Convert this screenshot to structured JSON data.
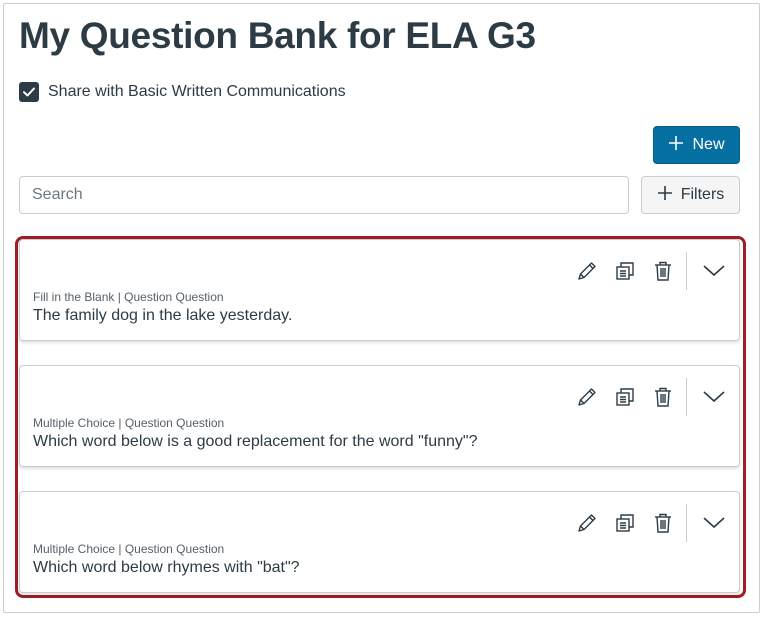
{
  "page": {
    "title": "My Question Bank for ELA G3"
  },
  "share": {
    "checked": true,
    "label": "Share with Basic Written Communications"
  },
  "toolbar": {
    "new_label": "New",
    "search_placeholder": "Search",
    "filters_label": "Filters"
  },
  "questions": [
    {
      "meta": "Fill in the Blank | Question Question",
      "text": "The family dog in the lake yesterday."
    },
    {
      "meta": "Multiple Choice | Question Question",
      "text": "Which word below is a good replacement for the word \"funny\"?"
    },
    {
      "meta": "Multiple Choice | Question Question",
      "text": "Which word below rhymes with \"bat\"?"
    }
  ],
  "icons": {
    "checkbox": "checkmark-icon",
    "new": "plus-icon",
    "filters": "plus-icon",
    "edit": "pencil-icon",
    "copy": "copy-icon",
    "delete": "trash-icon",
    "expand": "chevron-down-icon"
  },
  "colors": {
    "primary": "#0770a3",
    "text": "#2d3b45",
    "highlight": "#a01d24"
  }
}
